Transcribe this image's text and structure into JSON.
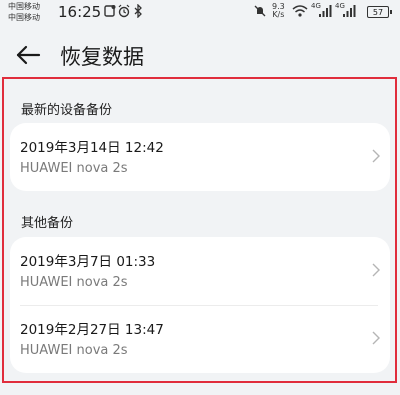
{
  "status_bar": {
    "carrier_1": "中国移动",
    "carrier_2": "中国移动",
    "time": "16:25",
    "net_speed_value": "9.3",
    "net_speed_unit": "K/s",
    "signal_1_label": "4G",
    "signal_2_label": "4G",
    "battery_level": "57"
  },
  "header": {
    "title": "恢复数据"
  },
  "sections": [
    {
      "title": "最新的设备备份",
      "items": [
        {
          "date": "2019年3月14日 12:42",
          "device": "HUAWEI nova 2s"
        }
      ]
    },
    {
      "title": "其他备份",
      "items": [
        {
          "date": "2019年3月7日 01:33",
          "device": "HUAWEI nova 2s"
        },
        {
          "date": "2019年2月27日 13:47",
          "device": "HUAWEI nova 2s"
        }
      ]
    }
  ],
  "colors": {
    "background": "#f1f3f5",
    "card": "#ffffff",
    "highlight_frame": "#e02d3c",
    "secondary_text": "#7a7a7a"
  }
}
